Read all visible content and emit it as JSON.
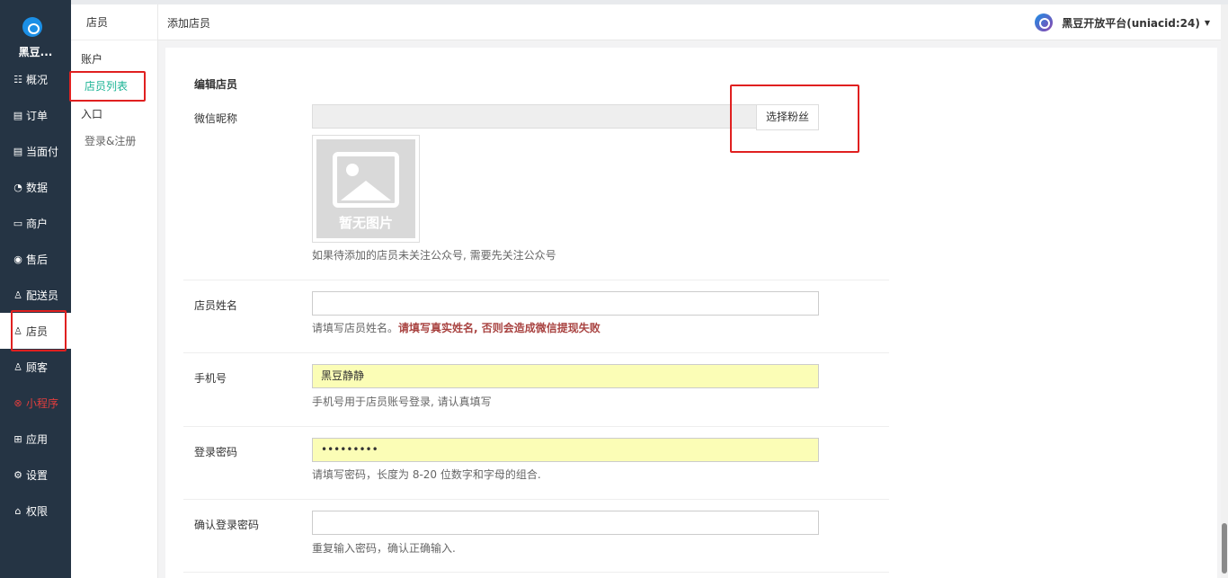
{
  "sidebar": {
    "logo_text": "黑豆...",
    "items": [
      {
        "icon": "dashboard-icon",
        "glyph": "☷",
        "label": "概况"
      },
      {
        "icon": "order-icon",
        "glyph": "▤",
        "label": "订单"
      },
      {
        "icon": "payment-icon",
        "glyph": "▤",
        "label": "当面付"
      },
      {
        "icon": "data-icon",
        "glyph": "◔",
        "label": "数据"
      },
      {
        "icon": "shop-icon",
        "glyph": "▭",
        "label": "商户"
      },
      {
        "icon": "aftersale-icon",
        "glyph": "◉",
        "label": "售后"
      },
      {
        "icon": "courier-icon",
        "glyph": "♙",
        "label": "配送员"
      },
      {
        "icon": "clerk-icon",
        "glyph": "♙",
        "label": "店员"
      },
      {
        "icon": "customer-icon",
        "glyph": "♙",
        "label": "顾客"
      },
      {
        "icon": "miniprogram-icon",
        "glyph": "⊗",
        "label": "小程序"
      },
      {
        "icon": "apps-icon",
        "glyph": "⊞",
        "label": "应用"
      },
      {
        "icon": "settings-icon",
        "glyph": "⚙",
        "label": "设置"
      },
      {
        "icon": "permission-icon",
        "glyph": "⌂",
        "label": "权限"
      }
    ],
    "active": "店员"
  },
  "submenu": {
    "title": "店员",
    "items": [
      "账户",
      "店员列表",
      "入口",
      "登录&注册"
    ],
    "active": "店员列表"
  },
  "topbar": {
    "breadcrumb": "添加店员",
    "account": "黑豆开放平台(uniacid:24)"
  },
  "form": {
    "heading": "编辑店员",
    "wechat_nickname": {
      "label": "微信昵称",
      "value": "",
      "button": "选择粉丝",
      "thumb_text": "暂无图片",
      "help": "如果待添加的店员未关注公众号, 需要先关注公众号"
    },
    "clerk_name": {
      "label": "店员姓名",
      "value": "",
      "help": "请填写店员姓名。",
      "help_warn": "请填写真实姓名, 否则会造成微信提现失败"
    },
    "phone": {
      "label": "手机号",
      "value": "黑豆静静",
      "help": "手机号用于店员账号登录, 请认真填写"
    },
    "password": {
      "label": "登录密码",
      "value": "•••••••••",
      "help": "请填写密码，长度为 8-20 位数字和字母的组合."
    },
    "password_confirm": {
      "label": "确认登录密码",
      "value": "",
      "help": "重复输入密码，确认正确输入."
    }
  }
}
